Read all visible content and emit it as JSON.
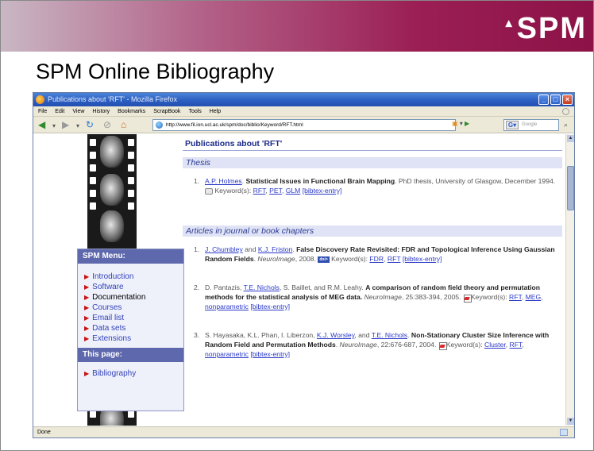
{
  "slide": {
    "logo": "SPM",
    "title": "SPM Online Bibliography"
  },
  "browser": {
    "window_title": "Publications about 'RFT' - Mozilla Firefox",
    "menu": [
      "File",
      "Edit",
      "View",
      "History",
      "Bookmarks",
      "ScrapBook",
      "Tools",
      "Help"
    ],
    "url": "http://www.fil.ion.ucl.ac.uk/spm/doc/biblio/Keyword/RFT.html",
    "search_placeholder": "Google",
    "status": "Done"
  },
  "sidebar": {
    "menu_title": "SPM Menu:",
    "items": [
      {
        "label": "Introduction"
      },
      {
        "label": "Software"
      },
      {
        "label": "Documentation"
      },
      {
        "label": "Courses"
      },
      {
        "label": "Email list"
      },
      {
        "label": "Data sets"
      },
      {
        "label": "Extensions"
      }
    ],
    "page_title": "This page:",
    "page_items": [
      {
        "label": "Bibliography"
      }
    ]
  },
  "page": {
    "heading": "Publications about 'RFT'",
    "sections": [
      {
        "title": "Thesis",
        "entries": [
          {
            "num": "1.",
            "author_link": "A.P. Holmes",
            "title": "Statistical Issues in Functional Brain Mapping",
            "after": ". PhD thesis, University of Glasgow, December 1994.",
            "keywords_label": "Keyword(s):",
            "keywords": [
              "RFT",
              "PET",
              "GLM"
            ],
            "bibtex": "[bibtex-entry]"
          }
        ]
      },
      {
        "title": "Articles in journal or book chapters",
        "entries": [
          {
            "num": "1.",
            "author1": "J. Chumbley",
            "and": " and ",
            "author2": "K.J. Friston",
            "title": "False Discovery Rate Revisited: FDR and Topological Inference Using Gaussian Random Fields",
            "journal": "NeuroImage",
            "year": ", 2008.",
            "doi": "doi>",
            "keywords_label": "Keyword(s):",
            "keywords": [
              "FDR",
              "RFT"
            ],
            "bibtex": "[bibtex-entry]"
          },
          {
            "num": "2.",
            "before": "D. Pantazis, ",
            "author_link": "T.E. Nichols",
            "after_author": ", S. Baillet, and R.M. Leahy.",
            "title": "A comparison of random field theory and permutation methods for the statistical analysis of MEG data.",
            "journal": "NeuroImage",
            "year": ", 25:383-394, 2005.",
            "keywords_label": "Keyword(s):",
            "keywords": [
              "RFT",
              "MEG",
              "nonparametric"
            ],
            "bibtex": "[bibtex-entry]"
          },
          {
            "num": "3.",
            "before": "S. Hayasaka, K.L. Phan, I. Liberzon, ",
            "author_link1": "K.J. Worsley",
            "and": ", and ",
            "author_link2": "T.E. Nichols",
            "title": "Non-Stationary Cluster Size Inference with Random Field and Permutation Methods",
            "journal": "NeuroImage",
            "year": ", 22:676-687, 2004.",
            "keywords_label": "Keyword(s):",
            "keywords": [
              "Cluster",
              "RFT",
              "nonparametric"
            ],
            "bibtex": "[bibtex-entry]"
          }
        ]
      }
    ]
  }
}
